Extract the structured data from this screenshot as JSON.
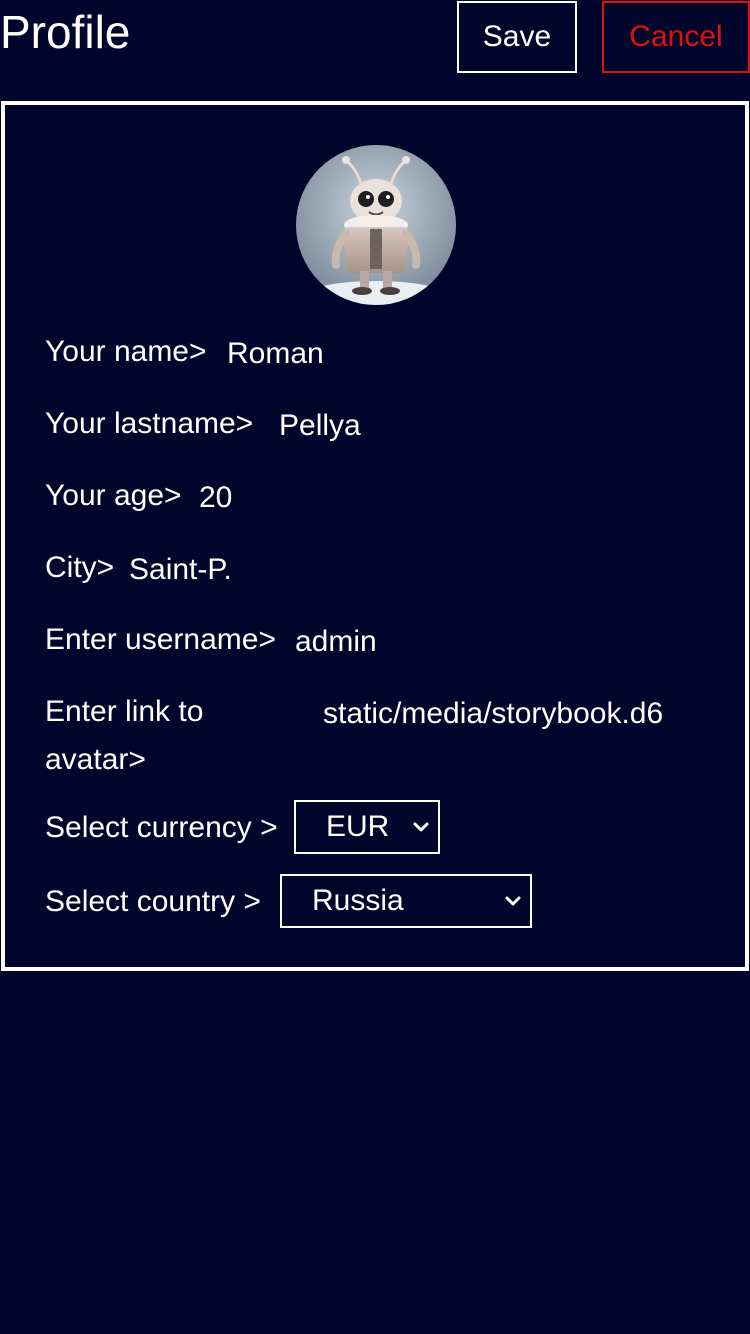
{
  "header": {
    "title": "Profile",
    "save_label": "Save",
    "cancel_label": "Cancel"
  },
  "form": {
    "name_label": "Your name>",
    "name_value": "Roman",
    "lastname_label": "Your lastname>",
    "lastname_value": "Pellya",
    "age_label": "Your age>",
    "age_value": "20",
    "city_label": "City>",
    "city_value": "Saint-P.",
    "username_label": "Enter username>",
    "username_value": "admin",
    "avatar_label_line1": "Enter link to",
    "avatar_label_line2": "avatar>",
    "avatar_value": "static/media/storybook.d6",
    "currency_label": "Select currency >",
    "currency_value": "EUR",
    "country_label": "Select country >",
    "country_value": "Russia"
  },
  "colors": {
    "background": "#00052b",
    "accent_danger": "#e20f0f",
    "text": "#ffffff"
  },
  "icons": {
    "avatar": "avatar-image",
    "select_chevron": "chevron-down-icon"
  }
}
